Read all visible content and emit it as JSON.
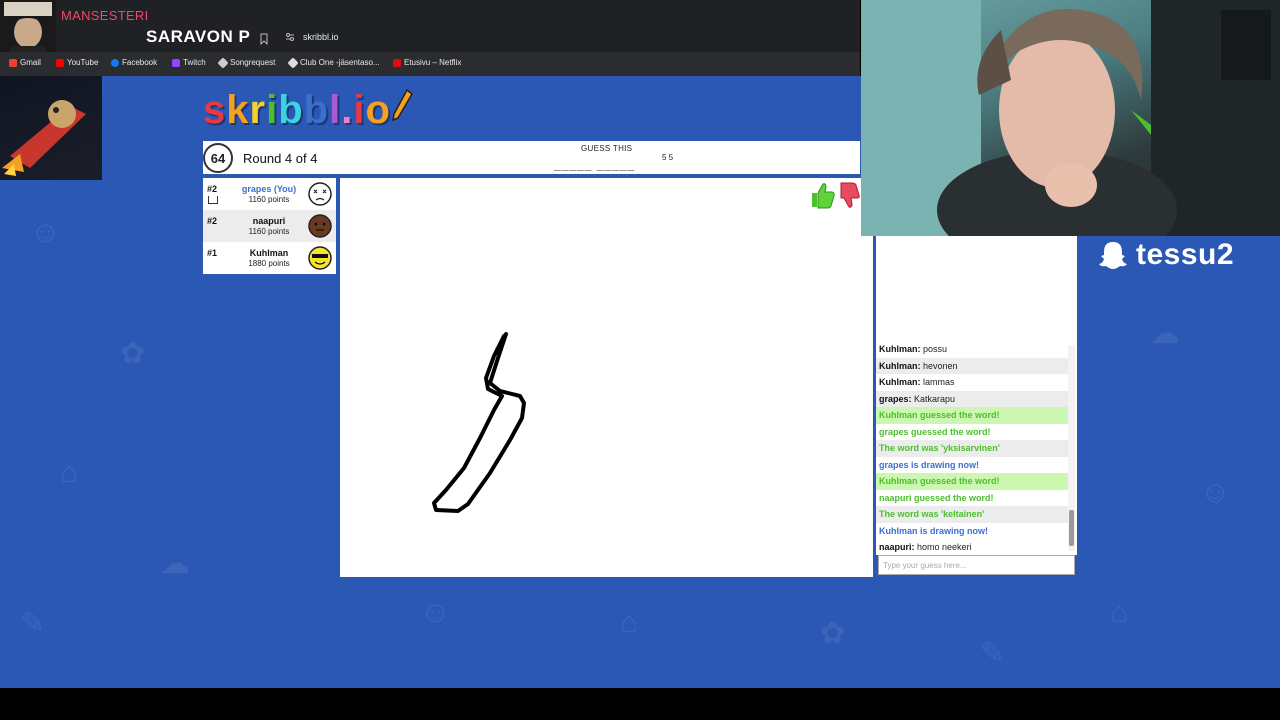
{
  "browser": {
    "tab_title": "SARAVON P",
    "url": "skribbl.io",
    "bookmarks": [
      {
        "label": "Gmail",
        "color": "#ea4335"
      },
      {
        "label": "YouTube",
        "color": "#ff0000"
      },
      {
        "label": "Facebook",
        "color": "#1877f2"
      },
      {
        "label": "Twitch",
        "color": "#9146ff"
      },
      {
        "label": "Songrequest",
        "color": "#cccccc"
      },
      {
        "label": "Club One -jäsentaso...",
        "color": "#dddddd"
      },
      {
        "label": "Etusivu – Netflix",
        "color": "#e50914"
      }
    ]
  },
  "stream": {
    "overlay_name": "MANSESTERI",
    "snapchat_handle": "tessu2"
  },
  "game": {
    "logo_letters": [
      {
        "ch": "s",
        "color": "#e63946"
      },
      {
        "ch": "k",
        "color": "#f4a021"
      },
      {
        "ch": "r",
        "color": "#f5d130"
      },
      {
        "ch": "i",
        "color": "#4cbf2c"
      },
      {
        "ch": "b",
        "color": "#3ad3e0"
      },
      {
        "ch": "b",
        "color": "#3a6fd0"
      },
      {
        "ch": "l",
        "color": "#a95ad8"
      },
      {
        "ch": ".",
        "color": "#f27ec8"
      },
      {
        "ch": "i",
        "color": "#e63946"
      },
      {
        "ch": "o",
        "color": "#f4a021"
      }
    ],
    "timer": "64",
    "round": "Round 4 of 4",
    "guess_label": "GUESS THIS",
    "word_hint": "_____ _____",
    "word_lengths": "5 5",
    "players": [
      {
        "rank": "#2",
        "name": "grapes (You)",
        "points": "1160 points",
        "is_you": true,
        "face_color": "#ffffff"
      },
      {
        "rank": "#2",
        "name": "naapuri",
        "points": "1160 points",
        "is_you": false,
        "face_color": "#6b3a22"
      },
      {
        "rank": "#1",
        "name": "Kuhlman",
        "points": "1880 points",
        "is_you": false,
        "face_color": "#f5e62b"
      }
    ]
  },
  "chat": {
    "messages": [
      {
        "type": "normal",
        "user": "Kuhlman:",
        "text": "possu"
      },
      {
        "type": "normal",
        "user": "Kuhlman:",
        "text": "hevonen"
      },
      {
        "type": "normal",
        "user": "Kuhlman:",
        "text": "lammas"
      },
      {
        "type": "normal",
        "user": "grapes:",
        "text": "Katkarapu"
      },
      {
        "type": "green",
        "text": "Kuhlman guessed the word!"
      },
      {
        "type": "green",
        "text": "grapes guessed the word!"
      },
      {
        "type": "green",
        "text": "The word was 'yksisarvinen'"
      },
      {
        "type": "blue",
        "text": "grapes is drawing now!"
      },
      {
        "type": "green",
        "text": "Kuhlman guessed the word!"
      },
      {
        "type": "green",
        "text": "naapuri guessed the word!"
      },
      {
        "type": "green",
        "text": "The word was 'keltainen'"
      },
      {
        "type": "blue",
        "text": "Kuhlman is drawing now!"
      },
      {
        "type": "normal",
        "user": "naapuri:",
        "text": "homo neekeri"
      }
    ],
    "input_placeholder": "Type your guess here..."
  }
}
